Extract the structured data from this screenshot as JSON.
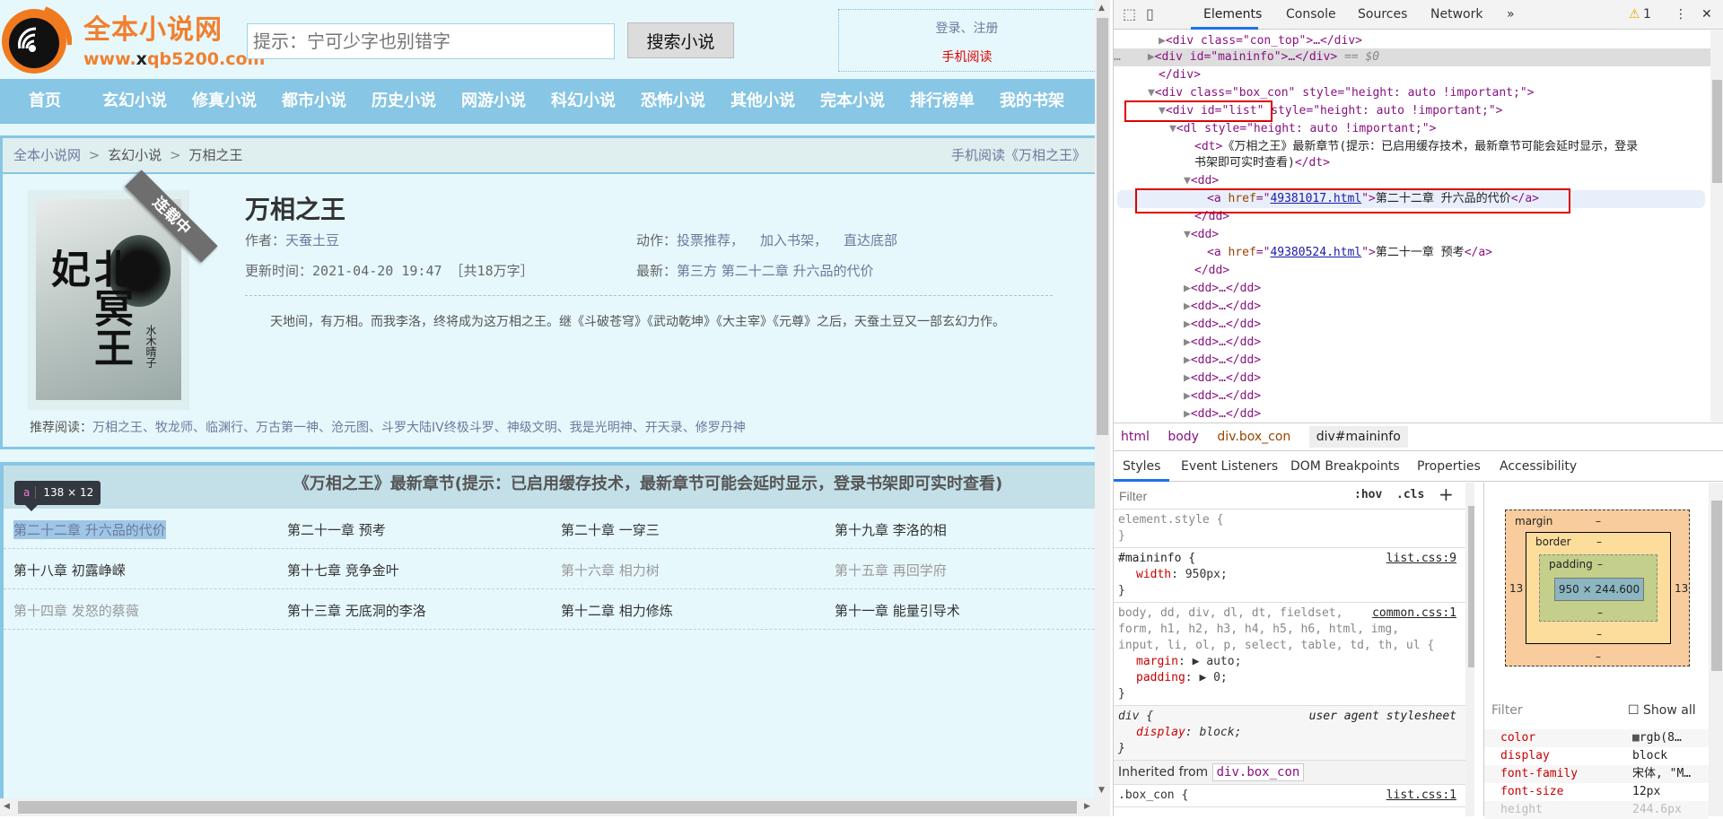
{
  "site": {
    "name": "全本小说网",
    "url_prefix": "www.",
    "url_x": "x",
    "url_rest": "qb5200.com",
    "search_placeholder": "提示：宁可少字也别错字",
    "search_button": "搜索小说",
    "login_link": "登录、注册",
    "mobile_link": "手机阅读"
  },
  "nav": [
    "首页",
    "玄幻小说",
    "修真小说",
    "都市小说",
    "历史小说",
    "网游小说",
    "科幻小说",
    "恐怖小说",
    "其他小说",
    "完本小说",
    "排行榜单",
    "我的书架"
  ],
  "breadcrumb": {
    "home": "全本小说网",
    "sep": ">",
    "category": "玄幻小说",
    "current": "万相之王",
    "mobile_read": "手机阅读《万相之王》"
  },
  "book": {
    "cover_title": "北冥王妃",
    "cover_author": "水木晴子",
    "status_ribbon": "连载中",
    "title": "万相之王",
    "author_label": "作者：",
    "author": "天蚕土豆",
    "update_label": "更新时间：",
    "update_time": "2021-04-20 19:47",
    "word_count": "［共18万字］",
    "actions_label": "动作：",
    "actions": [
      "投票推荐，",
      "加入书架，",
      "直达底部"
    ],
    "latest_label": "最新：",
    "latest": "第三方 第二十二章 升六品的代价",
    "description": "天地间，有万相。而我李洛，终将成为这万相之王。继《斗破苍穹》《武动乾坤》《大主宰》《元尊》之后，天蚕土豆又一部玄幻力作。"
  },
  "recommend": {
    "label": "推荐阅读：",
    "items": "万相之王、牧龙师、临渊行、万古第一神、沧元图、斗罗大陆IV终极斗罗、神级文明、我是光明神、开天录、修罗丹神"
  },
  "chapter_list": {
    "header": "《万相之王》最新章节(提示：已启用缓存技术，最新章节可能会延时显示，登录书架即可实时查看)",
    "rows": [
      [
        "第二十二章 升六品的代价",
        "第二十一章 预考",
        "第二十章 一穿三",
        "第十九章 李洛的相"
      ],
      [
        "第十八章 初露峥嵘",
        "第十七章 竞争金叶",
        "第十六章 相力树",
        "第十五章 再回学府"
      ],
      [
        "第十四章 发怒的蔡薇",
        "第十三章 无底洞的李洛",
        "第十二章 相力修炼",
        "第十一章 能量引导术"
      ]
    ],
    "visited": [
      [
        false,
        false,
        false,
        false
      ],
      [
        false,
        false,
        true,
        true
      ],
      [
        true,
        false,
        false,
        false
      ]
    ]
  },
  "inspector_tooltip": {
    "tag": "a",
    "size": "138 × 12"
  },
  "devtools": {
    "tabs": [
      "Elements",
      "Console",
      "Sources",
      "Network",
      "»"
    ],
    "warnings": "1",
    "dom": {
      "l1": "<div class=\"con_top\">…</div>",
      "l2_pre": "<div id=\"maininfo\">…</div>",
      "l2_eq": " == $0",
      "l3": "</div>",
      "l4_tag": "<div class=\"box_con\" style=\"height: auto !important;\">",
      "l5": "<div id=\"list\" style=\"height: auto !important;\">",
      "l6": "<dl style=\"height: auto !important;\">",
      "l7a": "《万相之王》最新章节(提示：已启用缓存技术，最新章节可能会延时显示，登录",
      "l7b": "书架即可实时查看)",
      "href1": "49381017.html",
      "text1": "第二十二章 升六品的代价",
      "href2": "49380524.html",
      "text2": "第二十一章 预考",
      "collapsed_dd": "<dd>…</dd>"
    },
    "crumbs": [
      "html",
      "body",
      "div.box_con",
      "div#maininfo"
    ],
    "sub_tabs": [
      "Styles",
      "Event Listeners",
      "DOM Breakpoints",
      "Properties",
      "Accessibility"
    ],
    "styles": {
      "filter_placeholder": "Filter",
      "hov": ":hov",
      "cls": ".cls",
      "plus": "+",
      "element_style": "element.style {",
      "maininfo_sel": "#maininfo {",
      "maininfo_src": "list.css:9",
      "maininfo_prop": "width",
      "maininfo_val": "950px;",
      "common_sel1": "body, dd, div, dl, dt, fieldset,",
      "common_src": "common.css:1",
      "common_sel2": "form, h1, h2, h3, h4, h5, h6, html, img,",
      "common_sel3": "input, li, ol, p, select, table, td, th, ul {",
      "margin_val": "▶ auto;",
      "padding_val": "▶ 0;",
      "div_sel": "div {",
      "ua": "user agent stylesheet",
      "display_val": "block;",
      "inherited_label": "Inherited from",
      "inherited_from": "div.box_con",
      "next_rule": ".box_con {",
      "next_src": "list.css:1"
    },
    "box_model": {
      "margin": "margin",
      "border": "border",
      "padding": "padding",
      "content": "950 × 244.600",
      "dash": "–",
      "margin_left": "13",
      "margin_right": "13"
    },
    "computed": {
      "filter_placeholder": "Filter",
      "show_all": "Show all",
      "props": [
        {
          "name": "color",
          "value": "rgb(8…"
        },
        {
          "name": "display",
          "value": "block"
        },
        {
          "name": "font-family",
          "value": "宋体, \"M…"
        },
        {
          "name": "font-size",
          "value": "12px"
        },
        {
          "name": "height",
          "value": "244.6px"
        }
      ]
    }
  }
}
